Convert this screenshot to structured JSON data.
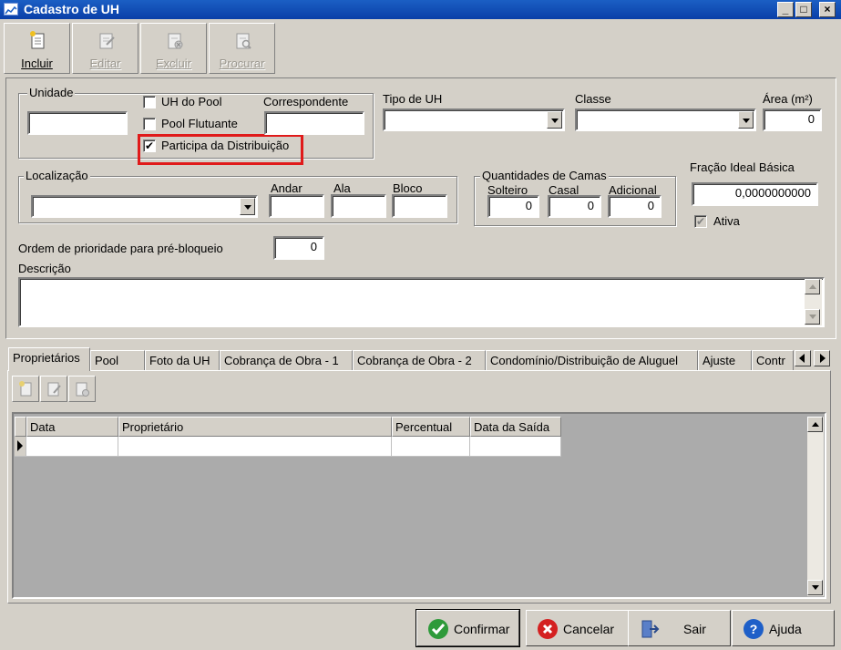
{
  "window": {
    "title": "Cadastro de UH",
    "controls": [
      "_",
      "□",
      "×"
    ]
  },
  "toolbar": {
    "incluir": "Incluir",
    "editar": "Editar",
    "excluir": "Excluir",
    "procurar": "Procurar"
  },
  "unidade": {
    "group_label": "Unidade",
    "value": "",
    "uh_do_pool_label": "UH do Pool",
    "uh_do_pool_checked": false,
    "pool_flutuante_label": "Pool Flutuante",
    "pool_flutuante_checked": false,
    "participa_label": "Participa da Distribuição",
    "participa_checked": true,
    "correspondente_label": "Correspondente",
    "correspondente_value": ""
  },
  "tipo_uh": {
    "label": "Tipo de UH",
    "value": ""
  },
  "classe": {
    "label": "Classe",
    "value": ""
  },
  "area": {
    "label": "Área (m²)",
    "value": "0"
  },
  "localizacao": {
    "group_label": "Localização",
    "value": "",
    "andar_label": "Andar",
    "andar_value": "",
    "ala_label": "Ala",
    "ala_value": "",
    "bloco_label": "Bloco",
    "bloco_value": ""
  },
  "camas": {
    "group_label": "Quantidades de Camas",
    "solteiro_label": "Solteiro",
    "solteiro_value": "0",
    "casal_label": "Casal",
    "casal_value": "0",
    "adicional_label": "Adicional",
    "adicional_value": "0"
  },
  "fracao": {
    "label": "Fração Ideal Básica",
    "value": "0,0000000000",
    "ativa_label": "Ativa",
    "ativa_checked": true
  },
  "ordem": {
    "label": "Ordem de prioridade para pré-bloqueio",
    "value": "0"
  },
  "descricao": {
    "label": "Descrição",
    "value": ""
  },
  "tabs": [
    {
      "label": "Proprietários"
    },
    {
      "label": "Pool"
    },
    {
      "label": "Foto da UH"
    },
    {
      "label": "Cobrança de Obra - 1"
    },
    {
      "label": "Cobrança de Obra - 2"
    },
    {
      "label": "Condomínio/Distribuição de Aluguel"
    },
    {
      "label": "Ajuste"
    },
    {
      "label": "Contr"
    }
  ],
  "grid": {
    "columns": [
      "Data",
      "Proprietário",
      "Percentual",
      "Data da Saída"
    ]
  },
  "buttons": {
    "confirmar": "Confirmar",
    "cancelar": "Cancelar",
    "sair": "Sair",
    "ajuda": "Ajuda"
  },
  "colors": {
    "titlebar": "#0a3fa8",
    "highlight_box": "#e01a1a",
    "confirm_icon": "#2e9a3a",
    "cancel_icon": "#d42020",
    "help_icon": "#1e5fc8"
  }
}
